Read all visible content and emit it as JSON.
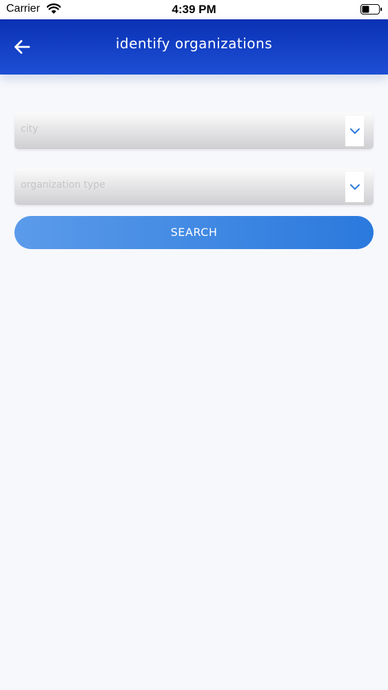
{
  "status_bar": {
    "carrier": "Carrier",
    "time": "4:39 PM",
    "icons": [
      "wifi-icon",
      "battery-icon"
    ]
  },
  "header": {
    "title": "identify organizations",
    "back_icon": "arrow-left-icon",
    "colors": {
      "top": "#0a31b3",
      "bottom": "#1d4fd6"
    }
  },
  "form": {
    "city": {
      "placeholder": "city",
      "value": ""
    },
    "organization_type": {
      "placeholder": "organization type",
      "value": ""
    },
    "dropdown_icon": "chevron-down-icon",
    "search_label": "SEARCH",
    "accent_color": "#2a79dd"
  }
}
